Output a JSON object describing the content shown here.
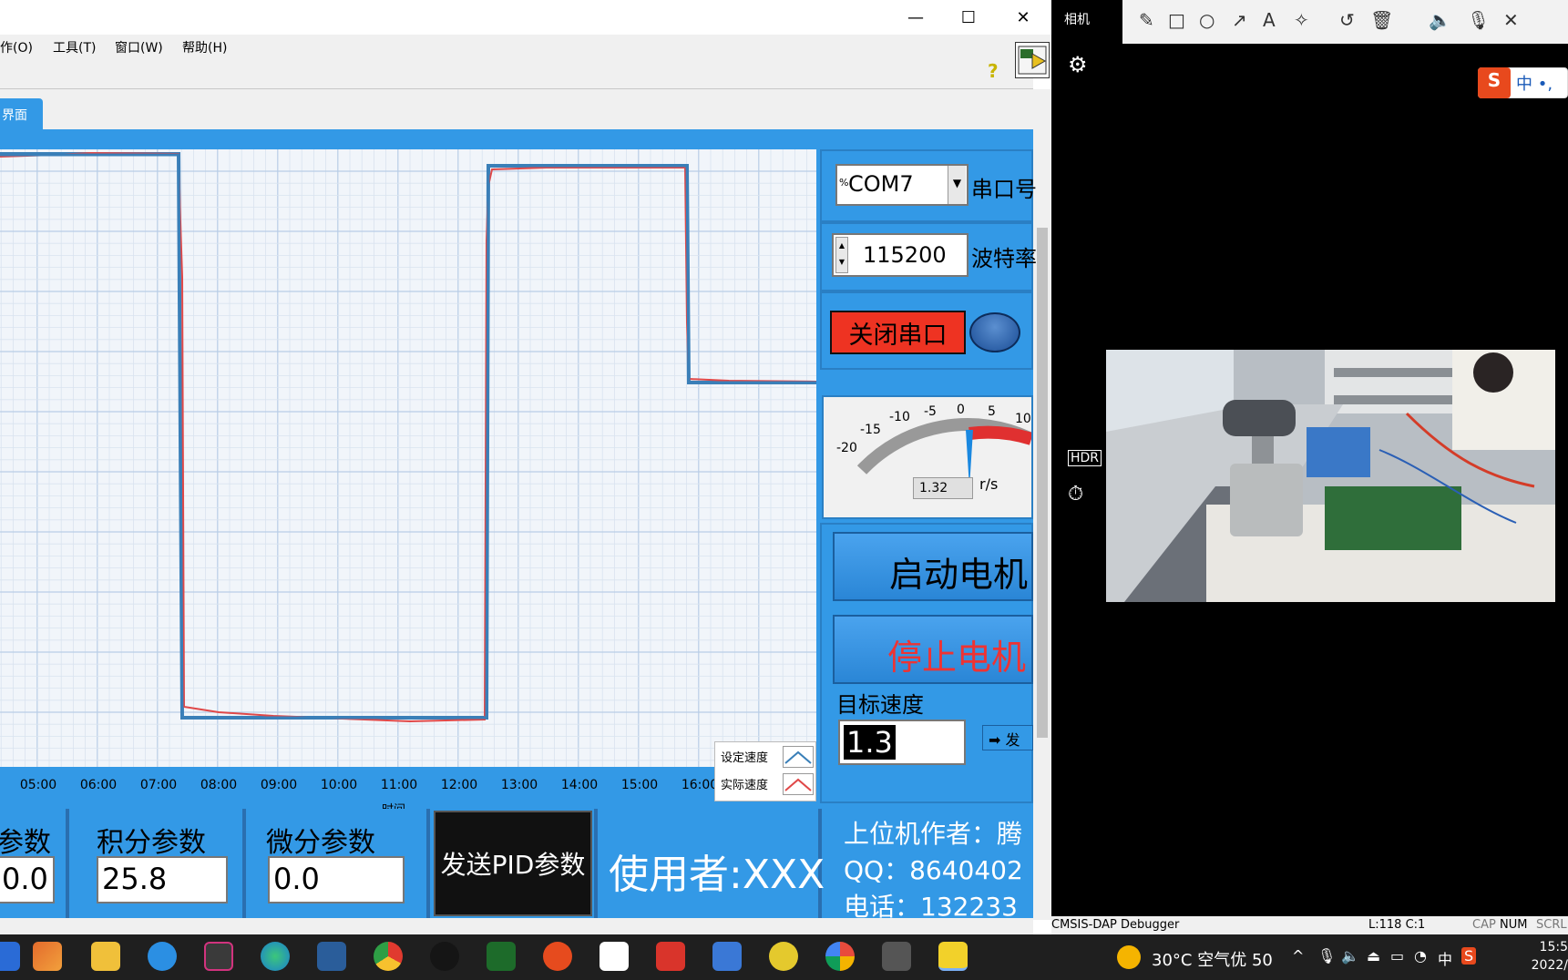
{
  "window": {
    "minimize": "—",
    "maximize": "☐",
    "close": "✕"
  },
  "menu": {
    "items": [
      "操作(O)",
      "工具(T)",
      "窗口(W)",
      "帮助(H)"
    ],
    "help_icon": "?"
  },
  "tab": {
    "label": "界面"
  },
  "chart": {
    "xlabel": "时间",
    "legend": [
      "设定速度",
      "实际速度"
    ],
    "colors": {
      "set": "#3a7fb8",
      "actual": "#e04848"
    }
  },
  "chart_data": {
    "type": "line",
    "x_tick_labels": [
      "05:00",
      "06:00",
      "07:00",
      "08:00",
      "09:00",
      "10:00",
      "11:00",
      "12:00",
      "13:00",
      "14:00",
      "15:00",
      "16:00"
    ],
    "xlabel": "时间",
    "ylabel": "",
    "series": [
      {
        "name": "设定速度",
        "color": "#3a7fb8"
      },
      {
        "name": "实际速度",
        "color": "#e04848"
      }
    ],
    "grid": true,
    "legend": "bottom-right"
  },
  "controls": {
    "com_value": "COM7",
    "com_prefix": "%",
    "com_label": "串口号",
    "baud_value": "115200",
    "baud_label": "波特率",
    "close_port": "关闭串口",
    "gauge": {
      "ticks": [
        "-20",
        "-15",
        "-10",
        "-5",
        "0",
        "5",
        "10"
      ],
      "value": "1.32",
      "unit": "r/s"
    },
    "start_motor": "启动电机",
    "stop_motor": "停止电机",
    "target_label": "目标速度",
    "target_value": "1.3",
    "send": "发"
  },
  "pid": {
    "p_label": "参数",
    "p_value": "0.0",
    "i_label": "积分参数",
    "i_value": "25.8",
    "d_label": "微分参数",
    "d_value": "0.0",
    "send_button": "发送PID参数"
  },
  "footer": {
    "user": "使用者:XXX",
    "author": "上位机作者：腾",
    "qq": "QQ：8640402",
    "phone": "电话：132233"
  },
  "camera_app": {
    "title": "相机",
    "ime_text": "中 •,"
  },
  "statusbar": {
    "app": "CMSIS-DAP Debugger",
    "position": "L:118 C:1",
    "caps": "CAP",
    "num": "NUM",
    "scrl": "SCRL"
  },
  "taskbar": {
    "temp": "30°C",
    "air": "空气优 50",
    "lang": "中",
    "time": "15:5",
    "date": "2022/"
  }
}
